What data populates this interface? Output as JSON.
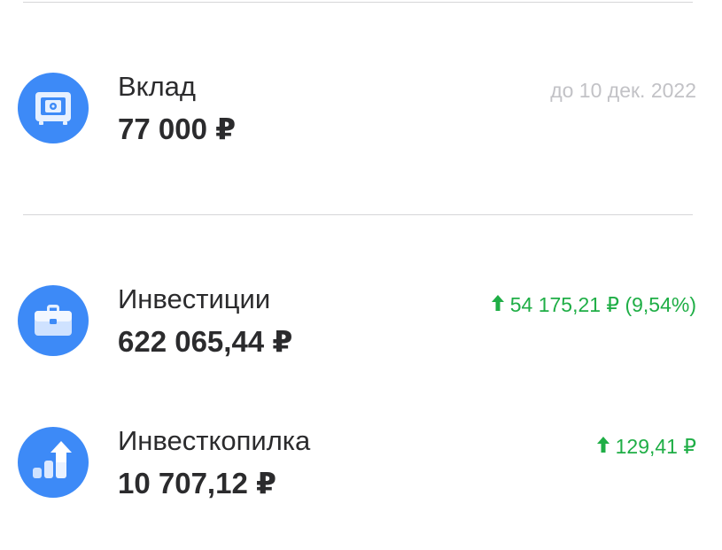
{
  "colors": {
    "icon_bg": "#3d8af7",
    "gain": "#1fae46",
    "muted": "#c2c2c6",
    "text": "#2b2b2d"
  },
  "items": [
    {
      "title": "Вклад",
      "amount": "77 000 ₽",
      "note": "до 10 дек. 2022",
      "icon": "safe-icon"
    },
    {
      "title": "Инвестиции",
      "amount": "622 065,44 ₽",
      "change": "54 175,21 ₽ (9,54%)",
      "icon": "briefcase-icon"
    },
    {
      "title": "Инвесткопилка",
      "amount": "10 707,12 ₽",
      "change": "129,41 ₽",
      "icon": "growth-chart-icon"
    }
  ]
}
